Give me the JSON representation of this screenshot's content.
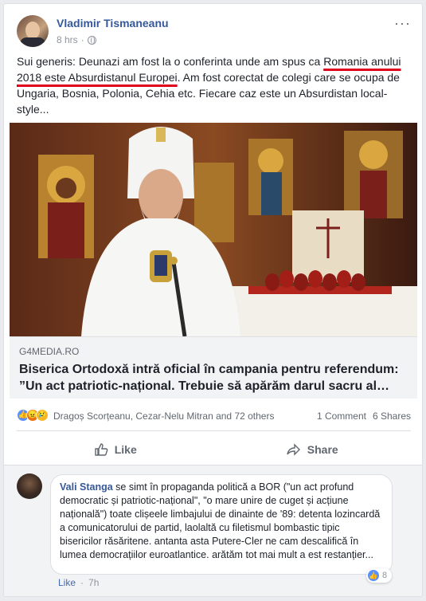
{
  "post": {
    "author": "Vladimir Tismaneanu",
    "time": "8 hrs",
    "text_before": "Sui generis: Deunazi am fost la o conferinta unde am spus ca ",
    "text_highlight": "Romania anului 2018 este Absurdistanul Europei",
    "text_after": ". Am fost corectat de colegi care se ocupa de Ungaria, Bosnia, Polonia, Cehia etc. Fiecare caz este un Absurdistan local-style..."
  },
  "link": {
    "domain": "G4MEDIA.RO",
    "title": "Biserica Ortodoxă intră oficial în campania pentru referendum: ”Un act patriotic-național. Trebuie să apărăm darul sacru al…"
  },
  "stats": {
    "reactors": "Dragoș Scorțeanu, Cezar-Nelu Mitran and 72 others",
    "comments": "1 Comment",
    "shares": "6 Shares"
  },
  "actions": {
    "like": "Like",
    "share": "Share"
  },
  "comment": {
    "name": "Vali Stanga",
    "text": " se simt în propaganda politică a BOR (\"un act profund democratic și patriotic-național\", \"o mare unire de cuget și acțiune națională\") toate clișeele limbajului de dinainte de '89: detenta lozincardă a comunicatorului de partid, laolaltă cu filetismul bombastic tipic bisericilor răsăritene. antanta asta Putere-Cler ne cam descalifică în lumea democrațiilor euroatlantice. arătăm tot mai mult a est restanțier...",
    "like": "Like",
    "time": "7h",
    "reactions": "8"
  },
  "colors": {
    "link_blue": "#365899",
    "underline_red": "#e0001b",
    "like_blue": "#4267b2"
  }
}
